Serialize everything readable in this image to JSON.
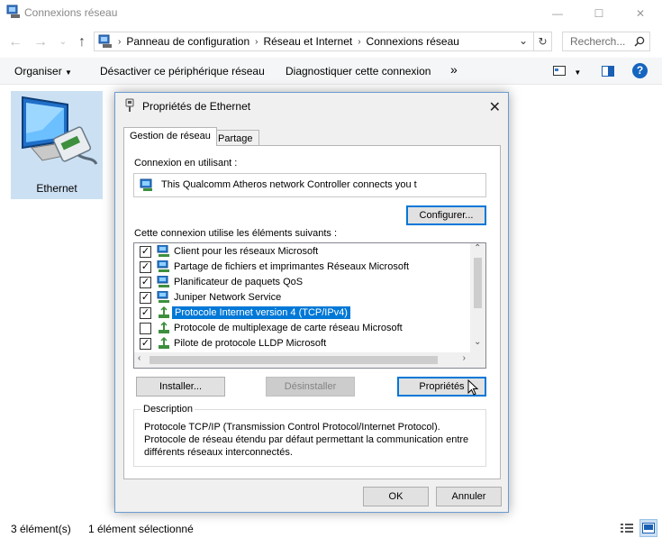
{
  "window": {
    "title": "Connexions réseau",
    "controls": {
      "minimize": "—",
      "maximize": "☐",
      "close": "✕"
    }
  },
  "address": {
    "crumbs": [
      "Panneau de configuration",
      "Réseau et Internet",
      "Connexions réseau"
    ],
    "search_placeholder": "Recherch..."
  },
  "toolbar": {
    "organize": "Organiser",
    "disable": "Désactiver ce périphérique réseau",
    "diagnose": "Diagnostiquer cette connexion",
    "more": "»",
    "help": "?"
  },
  "content": {
    "ethernet_label": "Ethernet"
  },
  "statusbar": {
    "count": "3 élément(s)",
    "selected": "1 élément sélectionné"
  },
  "dialog": {
    "title": "Propriétés de Ethernet",
    "tabs": [
      "Gestion de réseau",
      "Partage"
    ],
    "connect_using_label": "Connexion en utilisant :",
    "adapter_name": "This Qualcomm Atheros network Controller connects you t",
    "configure_button": "Configurer...",
    "items_label": "Cette connexion utilise les éléments suivants :",
    "items": [
      {
        "label": "Client pour les réseaux Microsoft",
        "checked": true,
        "icon": "network-client-icon"
      },
      {
        "label": "Partage de fichiers et imprimantes Réseaux Microsoft",
        "checked": true,
        "icon": "network-service-icon"
      },
      {
        "label": "Planificateur de paquets QoS",
        "checked": true,
        "icon": "network-service-icon"
      },
      {
        "label": "Juniper Network Service",
        "checked": true,
        "icon": "network-service-icon"
      },
      {
        "label": "Protocole Internet version 4 (TCP/IPv4)",
        "checked": true,
        "icon": "protocol-icon",
        "selected": true
      },
      {
        "label": "Protocole de multiplexage de carte réseau Microsoft",
        "checked": false,
        "icon": "protocol-icon"
      },
      {
        "label": "Pilote de protocole LLDP Microsoft",
        "checked": true,
        "icon": "protocol-icon"
      }
    ],
    "install_button": "Installer...",
    "uninstall_button": "Désinstaller",
    "properties_button": "Propriétés",
    "description_title": "Description",
    "description_text": "Protocole TCP/IP (Transmission Control Protocol/Internet Protocol). Protocole de réseau étendu par défaut permettant la communication entre différents réseaux interconnectés.",
    "ok_button": "OK",
    "cancel_button": "Annuler"
  },
  "colors": {
    "selection": "#0078d7",
    "tile_selected": "#cce0f3",
    "dialog_bg": "#f0f0f0",
    "help_icon": "#1565c0"
  }
}
